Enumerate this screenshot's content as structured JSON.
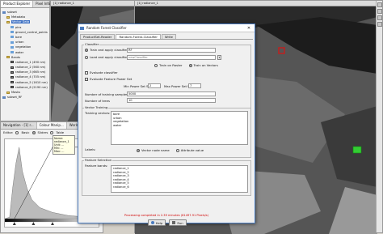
{
  "explorer": {
    "tabs": [
      "Product Explorer",
      "Pixel Info"
    ],
    "items": [
      {
        "label": "subset",
        "indent": 0,
        "icon": "product-icon"
      },
      {
        "label": "Metadata",
        "indent": 1,
        "icon": "folder-icon"
      },
      {
        "label": "Vector Data",
        "indent": 1,
        "icon": "folder-icon",
        "selected": true
      },
      {
        "label": "pins",
        "indent": 2,
        "icon": "vector-icon"
      },
      {
        "label": "ground_control_points",
        "indent": 2,
        "icon": "vector-icon"
      },
      {
        "label": "bare",
        "indent": 2,
        "icon": "vector-icon"
      },
      {
        "label": "urban",
        "indent": 2,
        "icon": "vector-icon"
      },
      {
        "label": "vegetation",
        "indent": 2,
        "icon": "vector-icon"
      },
      {
        "label": "water",
        "indent": 2,
        "icon": "vector-icon"
      },
      {
        "label": "Bands",
        "indent": 1,
        "icon": "folder-icon"
      },
      {
        "label": "radiance_1 (490 nm)",
        "indent": 2,
        "icon": "band-icon"
      },
      {
        "label": "radiance_2 (560 nm)",
        "indent": 2,
        "icon": "band-icon"
      },
      {
        "label": "radiance_3 (665 nm)",
        "indent": 2,
        "icon": "band-icon"
      },
      {
        "label": "radiance_4 (705 nm)",
        "indent": 2,
        "icon": "band-icon"
      },
      {
        "label": "radiance_5 (1610 nm)",
        "indent": 2,
        "icon": "band-icon"
      },
      {
        "label": "radiance_6 (2190 nm)",
        "indent": 2,
        "icon": "band-icon"
      },
      {
        "label": "Masks",
        "indent": 1,
        "icon": "folder-icon"
      },
      {
        "label": "subset_RF",
        "indent": 0,
        "icon": "product-icon"
      }
    ]
  },
  "nav": {
    "tabs": [
      "Navigation - [1] r...",
      "Colour Manip...",
      "World Vi"
    ],
    "editor_label": "Editor:",
    "mode_options": [
      "Basic",
      "Sliders",
      "Table"
    ],
    "tooltip": [
      "Name: radiance_1",
      "Unit: ...",
      "Min: ...",
      "Max: ..."
    ]
  },
  "viewers": {
    "left_tab": "[1] radiance_1",
    "right_tab": "[1] radiance_1"
  },
  "dialog": {
    "title": "Random Forest Classifier",
    "close": "✕",
    "tabs": [
      "ProductSet-Reader",
      "Random-Forest-Classifier",
      "Write"
    ],
    "classifier_group": "Classifier",
    "train_apply_label": "Train and apply classifier",
    "train_apply_value": "RF",
    "load_apply_label": "Load and apply classifier",
    "load_apply_value": "newClassifier",
    "train_on_raster": "Train on Raster",
    "train_on_vectors": "Train on Vectors",
    "evaluate_classifier": "Evaluate classifier",
    "evaluate_power_set": "Evaluate Feature Power Set",
    "min_power_label": "Min Power Set Size:",
    "min_power_value": "2",
    "max_power_label": "Max Power Set Size:",
    "max_power_value": "7",
    "num_training_label": "Number of training samples",
    "num_training_value": "5000",
    "num_trees_label": "Number of trees",
    "num_trees_value": "10",
    "vector_training_group": "Vector Training",
    "training_vectors_label": "Training vectors:",
    "training_vectors": [
      "bare",
      "urban",
      "vegetation",
      "water"
    ],
    "labels_label": "Labels:",
    "vector_node_name": "Vector node name",
    "attribute_value": "Attribute value",
    "feature_group": "Feature Selection",
    "feature_bands_label": "Feature bands:",
    "feature_bands": [
      "radiance_1",
      "radiance_2",
      "radiance_3",
      "radiance_4",
      "radiance_5",
      "radiance_6"
    ],
    "status": "Processing completed in 2.39 minutes (61497.91 Pixels/s)",
    "help_button": "Help",
    "run_button": "Run"
  },
  "colors": {
    "accent": "#3b6fc3",
    "status": "#d00000",
    "marker_red": "#c0201f",
    "marker_green": "#33cc33"
  }
}
